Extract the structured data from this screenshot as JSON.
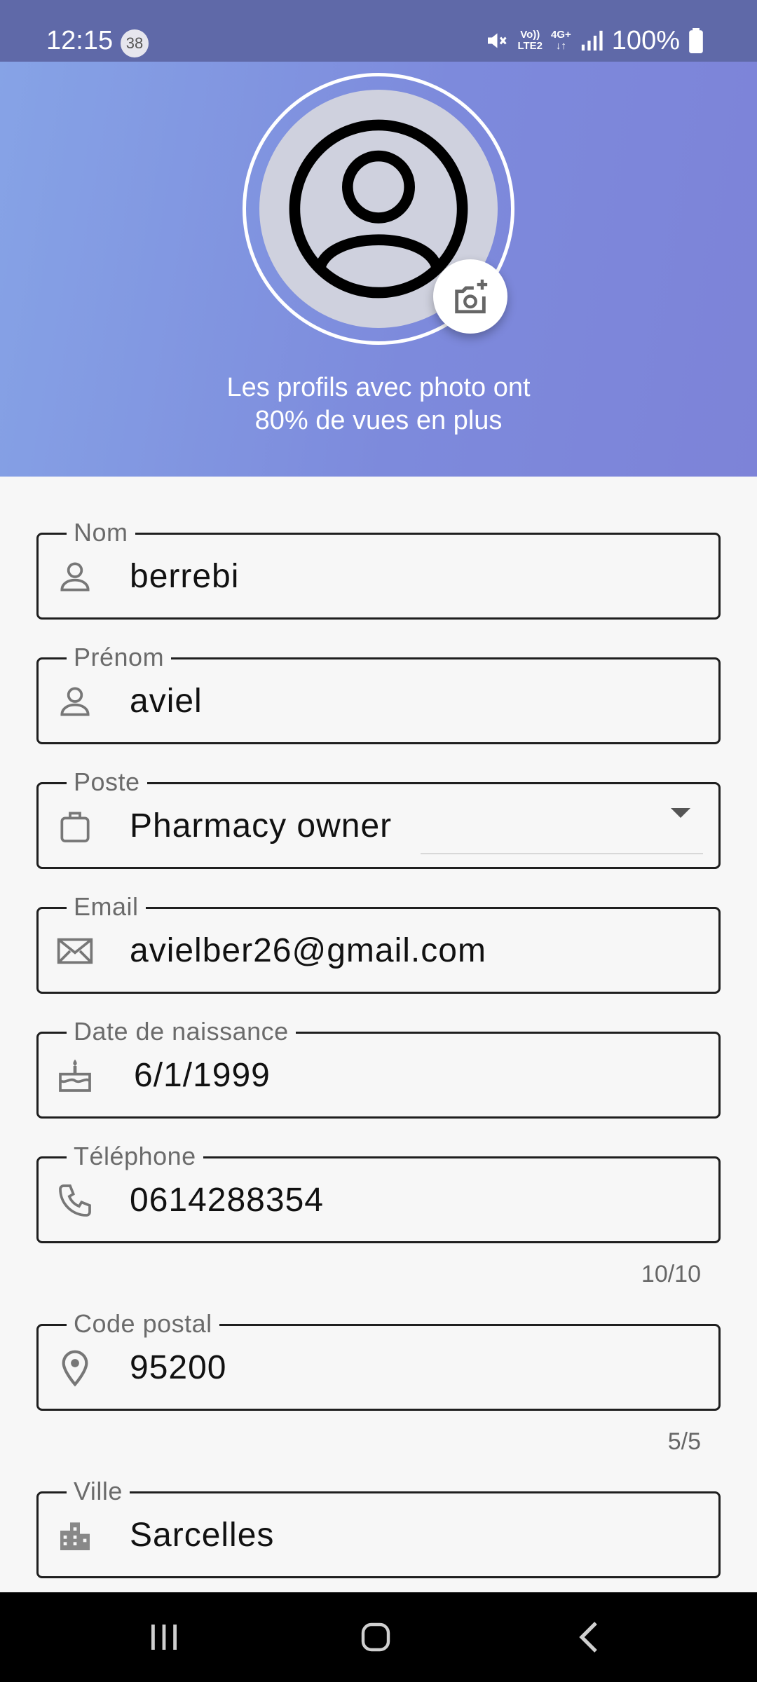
{
  "status_bar": {
    "time": "12:15",
    "notification_count": "38",
    "network_top": "Vo))",
    "network_bottom": "LTE2",
    "data_type": "4G+",
    "battery": "100%"
  },
  "header": {
    "message_line1": "Les profils avec photo ont",
    "message_line2": "80% de vues en plus",
    "gradient_start": "#86a3e6",
    "gradient_end": "#7d83d8"
  },
  "form": {
    "nom": {
      "label": "Nom",
      "value": "berrebi",
      "icon": "person-icon"
    },
    "prenom": {
      "label": "Prénom",
      "value": "aviel",
      "icon": "person-icon"
    },
    "poste": {
      "label": "Poste",
      "value": "Pharmacy owner",
      "icon": "briefcase-icon"
    },
    "email": {
      "label": "Email",
      "value": "avielber26@gmail.com",
      "icon": "mail-icon"
    },
    "naissance": {
      "label": "Date de naissance",
      "value": "6/1/1999",
      "icon": "cake-icon"
    },
    "telephone": {
      "label": "Téléphone",
      "value": "0614288354",
      "counter": "10/10",
      "icon": "phone-icon"
    },
    "code_postal": {
      "label": "Code postal",
      "value": "95200",
      "counter": "5/5",
      "icon": "location-pin-icon"
    },
    "ville": {
      "label": "Ville",
      "value": "Sarcelles",
      "icon": "city-icon"
    }
  }
}
